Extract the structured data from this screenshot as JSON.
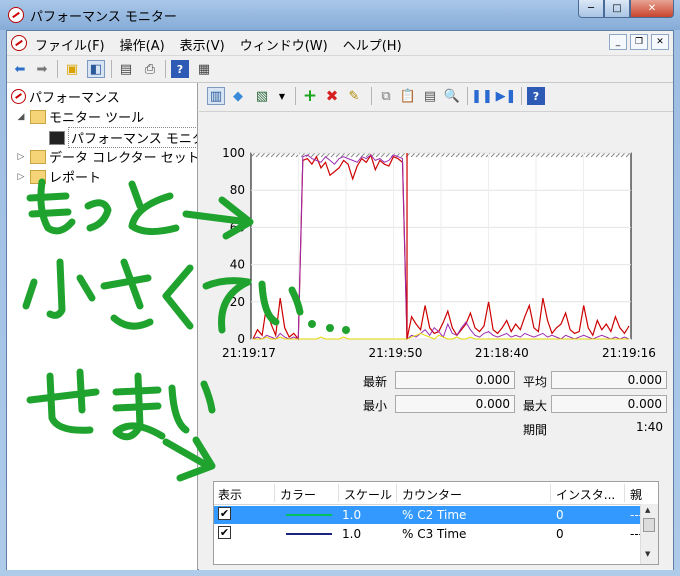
{
  "window": {
    "title": "パフォーマンス モニター",
    "caption_buttons": {
      "minimize": "─",
      "maximize": "□",
      "close": "✕"
    }
  },
  "menubar": {
    "items": [
      "ファイル(F)",
      "操作(A)",
      "表示(V)",
      "ウィンドウ(W)",
      "ヘルプ(H)"
    ],
    "mdi_buttons": {
      "minimize": "_",
      "restore": "❐",
      "close": "✕"
    }
  },
  "tree": {
    "root": "パフォーマンス",
    "monitor_tools": "モニター ツール",
    "perf_monitor": "パフォーマンス モニタ",
    "data_collector": "データ コレクター セット",
    "reports": "レポート"
  },
  "chart_data": {
    "type": "line",
    "yticks": [
      "100",
      "80",
      "60",
      "40",
      "20",
      "0"
    ],
    "ylim": [
      0,
      100
    ],
    "xlabels": [
      "21:19:17",
      "21:19:50",
      "21:18:40",
      "21:19:16"
    ],
    "grid": true,
    "series": [
      {
        "color": "#cc0000",
        "values": [
          0,
          5,
          2,
          18,
          8,
          2,
          22,
          6,
          1,
          3,
          0,
          96,
          97,
          94,
          98,
          92,
          95,
          88,
          90,
          92,
          96,
          94,
          86,
          93,
          97,
          95,
          99,
          91,
          96,
          94,
          93,
          98,
          97,
          95,
          0,
          12,
          8,
          5,
          18,
          6,
          3,
          4,
          9,
          15,
          6,
          2,
          5,
          8,
          14,
          6,
          4,
          7,
          20,
          5,
          3,
          6,
          10,
          4,
          8,
          5,
          12,
          18,
          6,
          4,
          22,
          10,
          3,
          6,
          8,
          14,
          5,
          3,
          4,
          18,
          6,
          2,
          10,
          5,
          8,
          4,
          12,
          6,
          3,
          7
        ]
      },
      {
        "color": "#9c2bb3",
        "values": [
          0,
          1,
          0,
          2,
          1,
          0,
          3,
          1,
          0,
          1,
          0,
          98,
          99,
          97,
          96,
          95,
          98,
          96,
          94,
          97,
          98,
          97,
          96,
          95,
          98,
          97,
          99,
          96,
          97,
          95,
          96,
          99,
          98,
          97,
          0,
          2,
          1,
          3,
          5,
          2,
          6,
          4,
          1,
          8,
          3,
          2,
          6,
          9,
          5,
          2,
          1,
          3,
          4,
          2,
          1,
          2,
          3,
          1,
          2,
          1,
          3,
          2,
          1,
          2,
          3,
          1,
          2,
          1,
          0,
          2,
          1,
          0,
          1,
          2,
          1,
          0,
          1,
          2,
          1,
          0,
          1,
          0,
          1,
          0
        ]
      },
      {
        "color": "#e6d700",
        "values": [
          0,
          0,
          0,
          1,
          0,
          0,
          1,
          0,
          0,
          0,
          0,
          0,
          0,
          0,
          0,
          1,
          0,
          0,
          0,
          0,
          1,
          0,
          0,
          0,
          0,
          0,
          0,
          0,
          0,
          0,
          0,
          0,
          0,
          0,
          0,
          1,
          2,
          3,
          2,
          1,
          0,
          2,
          1,
          0,
          0,
          1,
          0,
          0,
          1,
          0,
          0,
          0,
          0,
          0,
          0,
          0,
          0,
          0,
          0,
          0,
          0,
          0,
          0,
          0,
          0,
          0,
          0,
          0,
          0,
          0,
          0,
          0,
          0,
          0,
          0,
          0,
          0,
          0,
          0,
          0,
          0,
          0,
          0,
          0
        ]
      }
    ]
  },
  "stats": {
    "latest_label": "最新",
    "latest_value": "0.000",
    "avg_label": "平均",
    "avg_value": "0.000",
    "min_label": "最小",
    "min_value": "0.000",
    "max_label": "最大",
    "max_value": "0.000",
    "period_label": "期間",
    "period_value": "1:40"
  },
  "counter_table": {
    "columns": [
      "表示",
      "カラー",
      "スケール",
      "カウンター",
      "インスタ...",
      "親"
    ],
    "rows": [
      {
        "checked": "✔",
        "color": "#00c060",
        "scale": "1.0",
        "counter": "% C2 Time",
        "instance": "0",
        "parent": "---"
      },
      {
        "checked": "✔",
        "color": "#1a237e",
        "scale": "1.0",
        "counter": "% C3 Time",
        "instance": "0",
        "parent": "---"
      }
    ]
  },
  "annotation": {
    "line1": "もっと→",
    "line2": "小さくていい...",
    "line3": "せまい"
  }
}
